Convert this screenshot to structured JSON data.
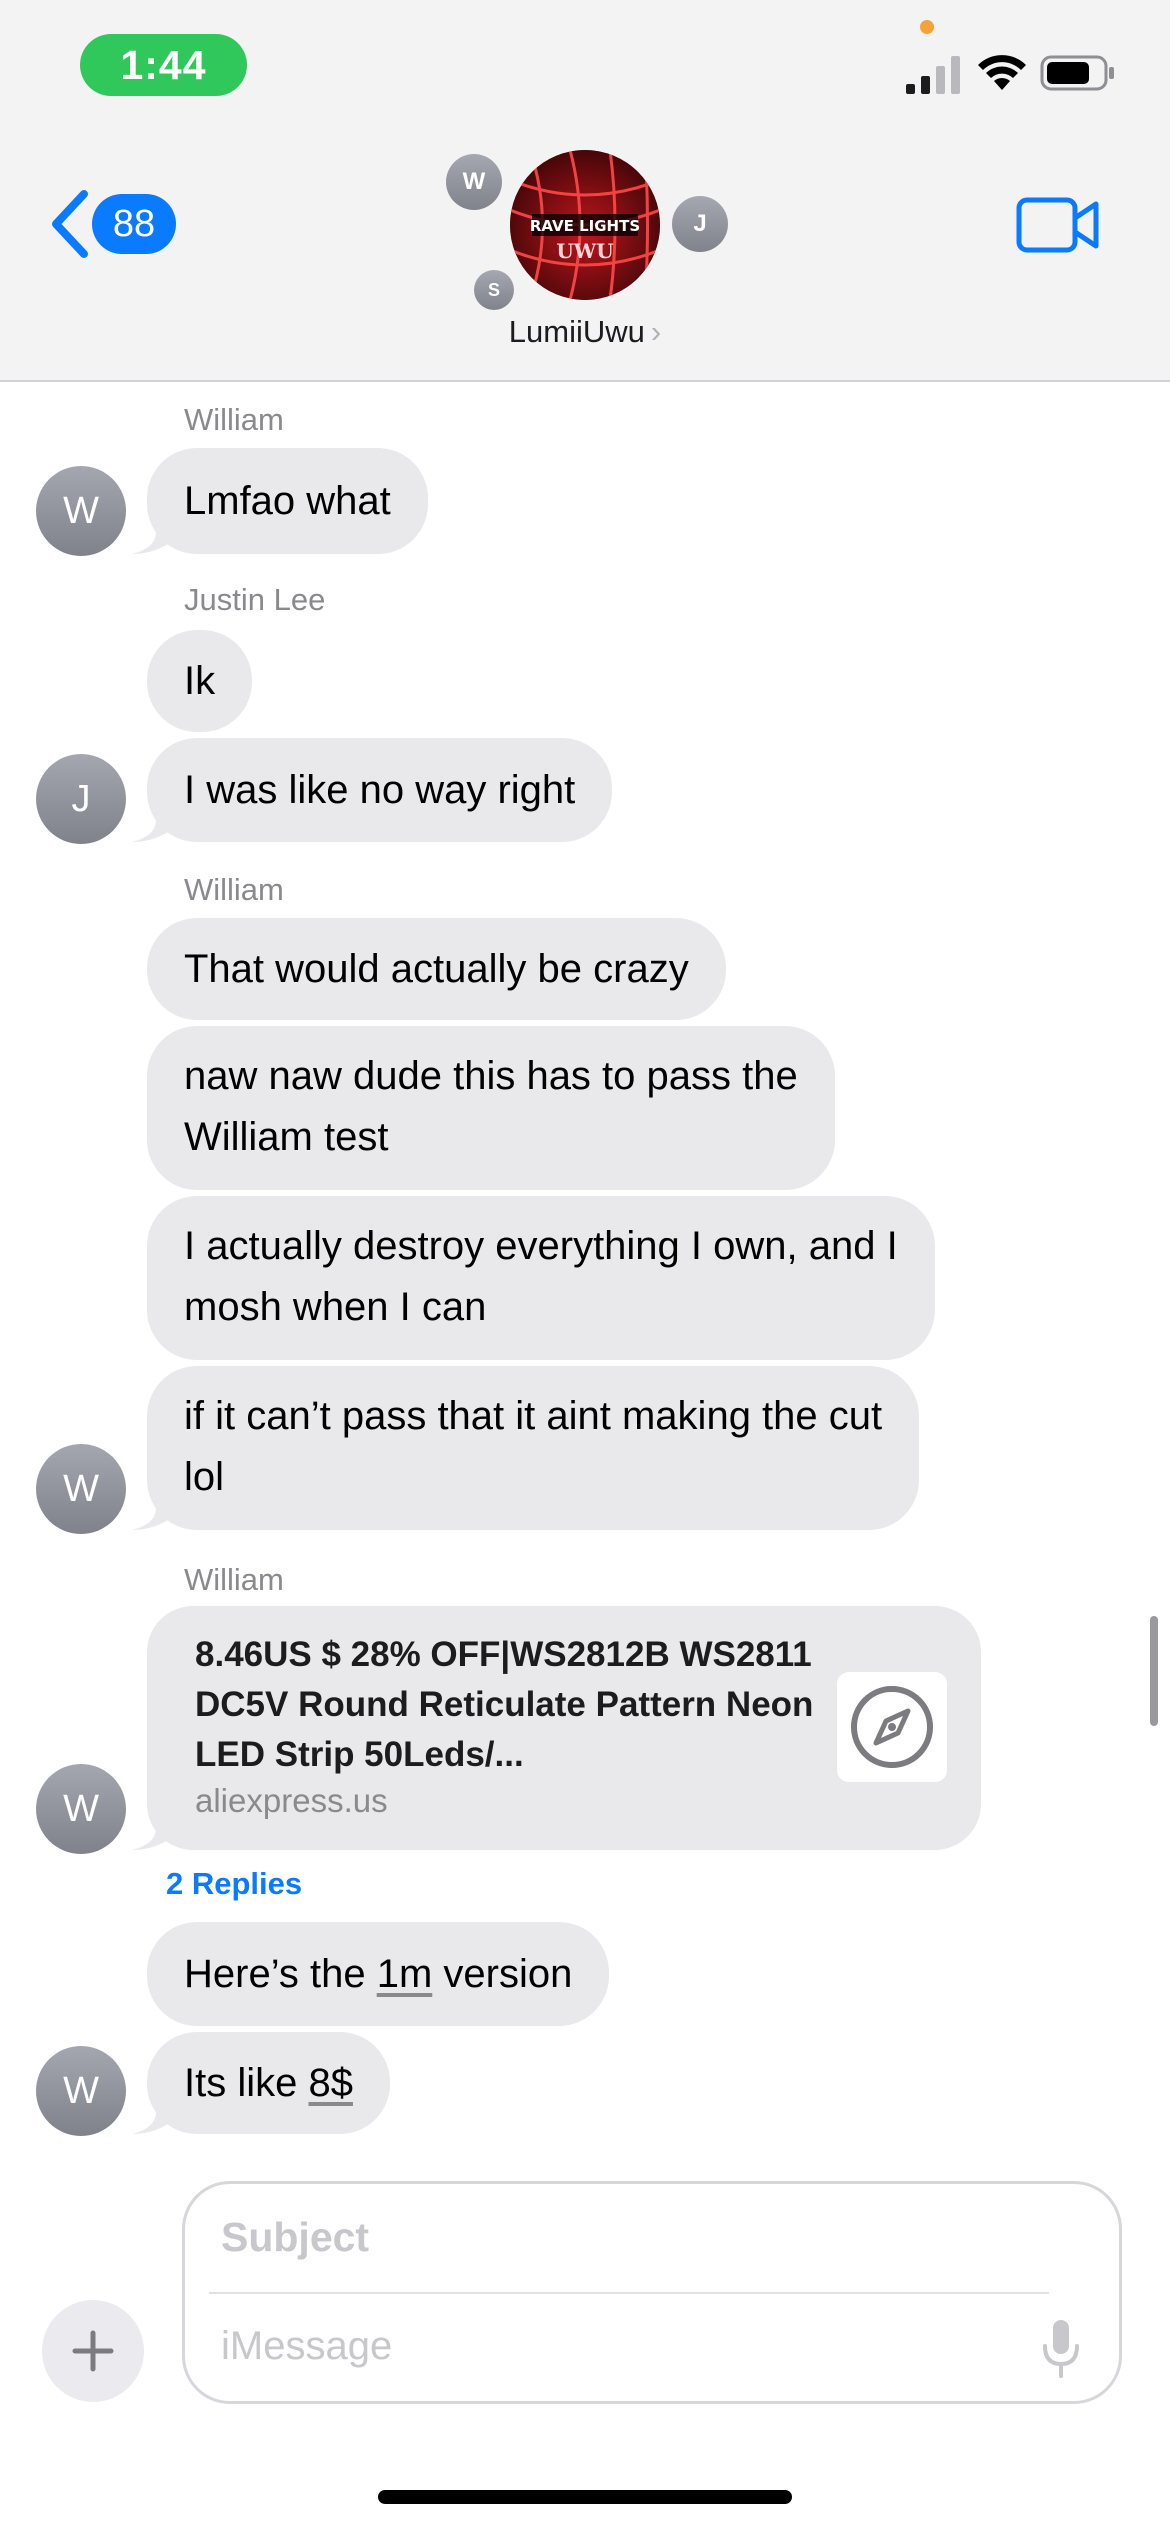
{
  "status_bar": {
    "time": "1:44"
  },
  "header": {
    "back_count": "88",
    "group_name": "LumiiUwu",
    "avatar_text_top": "RAVE LIGHTS",
    "avatar_text_bottom": "UWU",
    "member_initials": [
      "W",
      "J",
      "S"
    ]
  },
  "messages": {
    "sender1": "William",
    "m1": "Lmfao what",
    "sender2": "Justin Lee",
    "m2": "Ik",
    "m3": "I was like no way right",
    "sender3": "William",
    "m4": "That would actually be crazy",
    "m5_l1": "naw naw dude this has to pass the",
    "m5_l2": "William test",
    "m6_l1": "I actually destroy everything I own, and I",
    "m6_l2": "mosh when I can",
    "m7_l1": "if it can’t pass that it aint making the cut",
    "m7_l2": "lol",
    "sender4": "William",
    "link_title": "8.46US $ 28% OFF|WS2812B WS2811 DC5V Round Reticulate Pattern Neon LED Strip 50Leds/...",
    "link_domain": "aliexpress.us",
    "replies": "2 Replies",
    "m8_pre": "Here’s the ",
    "m8_link": "1m",
    "m8_post": " version",
    "m9_pre": "Its like ",
    "m9_link": "8$",
    "avatar_w": "W",
    "avatar_j": "J"
  },
  "compose": {
    "subject_placeholder": "Subject",
    "message_placeholder": "iMessage"
  },
  "colors": {
    "accent": "#0a7aff",
    "bubble": "#e9e9eb",
    "time_pill": "#30c85a"
  }
}
